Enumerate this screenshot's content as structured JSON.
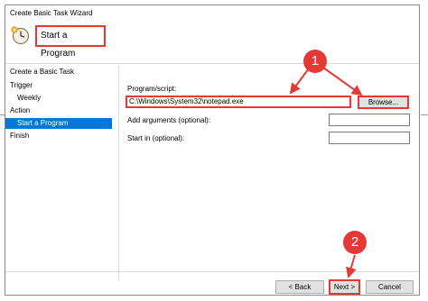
{
  "window": {
    "title": "Create Basic Task Wizard"
  },
  "header": {
    "page_title": "Start a Program"
  },
  "sidebar": {
    "items": [
      {
        "label": "Create a Basic Task"
      },
      {
        "label": "Trigger"
      },
      {
        "label": "Weekly"
      },
      {
        "label": "Action"
      },
      {
        "label": "Start a Program"
      },
      {
        "label": "Finish"
      }
    ]
  },
  "form": {
    "program_label": "Program/script:",
    "program_value": "C:\\Windows\\System32\\notepad.exe",
    "browse_label": "Browse...",
    "arguments_label": "Add arguments (optional):",
    "arguments_value": "",
    "start_in_label": "Start in (optional):",
    "start_in_value": ""
  },
  "footer": {
    "back_label": "< Back",
    "next_label": "Next >",
    "cancel_label": "Cancel"
  },
  "annotations": {
    "badge_1": "1",
    "badge_2": "2",
    "highlight_color": "#e53935"
  },
  "colors": {
    "selection": "#0078d7"
  },
  "icons": {
    "task_icon": "clock-gear-icon"
  }
}
